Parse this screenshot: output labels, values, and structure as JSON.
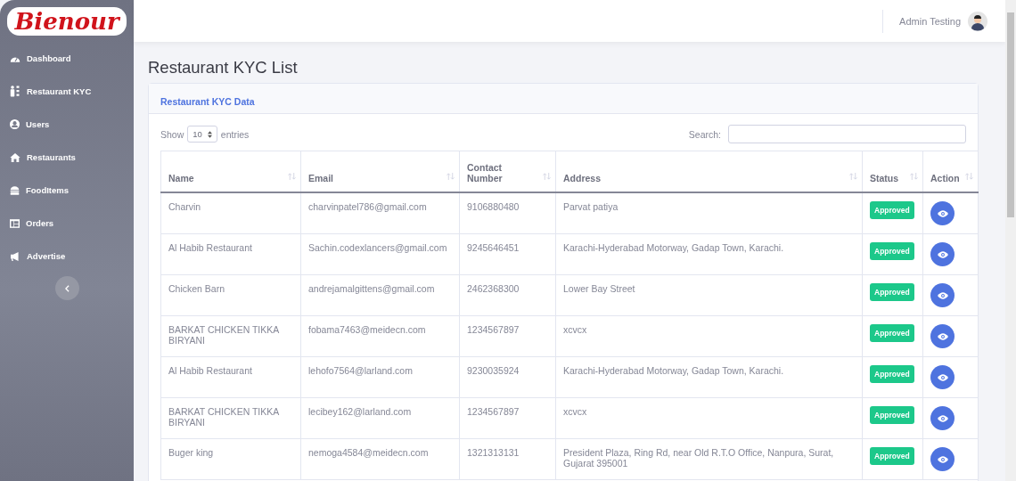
{
  "brand": {
    "logo": "Bienour"
  },
  "sidebar": {
    "items": [
      {
        "label": "Dashboard"
      },
      {
        "label": "Restaurant KYC"
      },
      {
        "label": "Users"
      },
      {
        "label": "Restaurants"
      },
      {
        "label": "FoodItems"
      },
      {
        "label": "Orders"
      },
      {
        "label": "Advertise"
      }
    ]
  },
  "topbar": {
    "user_name": "Admin Testing"
  },
  "page": {
    "title": "Restaurant KYC List"
  },
  "card": {
    "title": "Restaurant KYC Data",
    "length": {
      "label_before": "Show",
      "value": "10",
      "label_after": "entries"
    },
    "search": {
      "label": "Search:"
    },
    "table": {
      "columns": [
        "Name",
        "Email",
        "Contact Number",
        "Address",
        "Status",
        "Action"
      ],
      "rows": [
        {
          "name": "Charvin",
          "email": "charvinpatel786@gmail.com",
          "contact": "9106880480",
          "address": "Parvat patiya",
          "status": "Approved"
        },
        {
          "name": "Al Habib Restaurant",
          "email": "Sachin.codexlancers@gmail.com",
          "contact": "9245646451",
          "address": "Karachi-Hyderabad Motorway, Gadap Town, Karachi.",
          "status": "Approved"
        },
        {
          "name": "Chicken Barn",
          "email": "andrejamalgittens@gmail.com",
          "contact": "2462368300",
          "address": "Lower Bay Street",
          "status": "Approved"
        },
        {
          "name": "BARKAT CHICKEN TIKKA BIRYANI",
          "email": "fobama7463@meidecn.com",
          "contact": "1234567897",
          "address": "xcvcx",
          "status": "Approved"
        },
        {
          "name": "Al Habib Restaurant",
          "email": "lehofo7564@larland.com",
          "contact": "9230035924",
          "address": "Karachi-Hyderabad Motorway, Gadap Town, Karachi.",
          "status": "Approved"
        },
        {
          "name": "BARKAT CHICKEN TIKKA BIRYANI",
          "email": "lecibey162@larland.com",
          "contact": "1234567897",
          "address": "xcvcx",
          "status": "Approved"
        },
        {
          "name": "Buger king",
          "email": "nemoga4584@meidecn.com",
          "contact": "1321313131",
          "address": "President Plaza, Ring Rd, near Old R.T.O Office, Nanpura, Surat, Gujarat 395001",
          "status": "Approved"
        }
      ]
    }
  }
}
